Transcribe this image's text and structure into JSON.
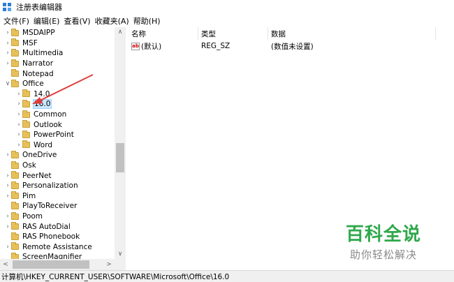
{
  "window": {
    "title": "注册表编辑器"
  },
  "menu": [
    "文件(F)",
    "编辑(E)",
    "查看(V)",
    "收藏夹(A)",
    "帮助(H)"
  ],
  "tree": [
    {
      "label": "MSDAIPP",
      "expander": ">"
    },
    {
      "label": "MSF",
      "expander": ">"
    },
    {
      "label": "Multimedia",
      "expander": ">"
    },
    {
      "label": "Narrator",
      "expander": ">"
    },
    {
      "label": "Notepad",
      "expander": ""
    },
    {
      "label": "Office",
      "expander": "v"
    },
    {
      "label": "14.0",
      "expander": ">"
    },
    {
      "label": "16.0",
      "expander": ">"
    },
    {
      "label": "Common",
      "expander": ">"
    },
    {
      "label": "Outlook",
      "expander": ">"
    },
    {
      "label": "PowerPoint",
      "expander": ">"
    },
    {
      "label": "Word",
      "expander": ">"
    },
    {
      "label": "OneDrive",
      "expander": ">"
    },
    {
      "label": "Osk",
      "expander": ""
    },
    {
      "label": "PeerNet",
      "expander": ">"
    },
    {
      "label": "Personalization",
      "expander": ">"
    },
    {
      "label": "Pim",
      "expander": ">"
    },
    {
      "label": "PlayToReceiver",
      "expander": ""
    },
    {
      "label": "Poom",
      "expander": ">"
    },
    {
      "label": "RAS AutoDial",
      "expander": ">"
    },
    {
      "label": "RAS Phonebook",
      "expander": ""
    },
    {
      "label": "Remote Assistance",
      "expander": ">"
    },
    {
      "label": "ScreenMagnifier",
      "expander": ""
    }
  ],
  "list": {
    "headers": {
      "name": "名称",
      "type": "类型",
      "data": "数据"
    },
    "rows": [
      {
        "name": "(默认)",
        "type": "REG_SZ",
        "data": "(数值未设置)",
        "icon": "string-value-icon"
      }
    ]
  },
  "status": {
    "path": "计算机\\HKEY_CURRENT_USER\\SOFTWARE\\Microsoft\\Office\\16.0"
  },
  "watermark": {
    "main": "百科全说",
    "sub": "助你轻松解决"
  },
  "colors": {
    "selected_bg": "#cce8ff",
    "arrow": "#e03c3c",
    "watermark": "#2fa84a"
  }
}
